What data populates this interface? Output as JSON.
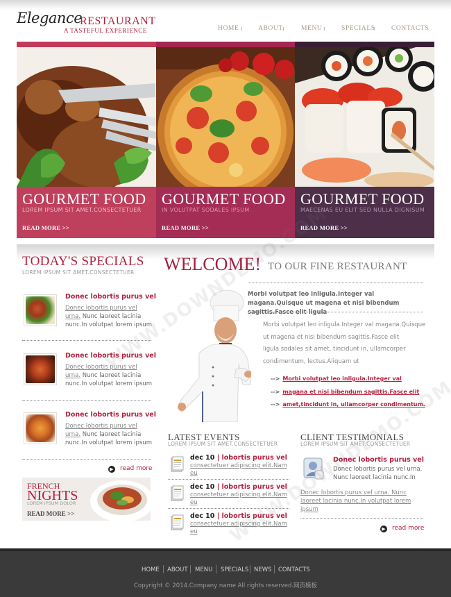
{
  "logo": {
    "script": "Elegance",
    "word": "RESTAURANT",
    "tagline": "A TASTEFUL EXPERIENCE"
  },
  "nav": {
    "items": [
      "HOME",
      "ABOUT",
      "MENU",
      "SPECIALS",
      "CONTACTS"
    ]
  },
  "banner": [
    {
      "title": "GOURMET FOOD",
      "subtitle": "LOREM IPSUM SIT AMET.CONSECTETUER",
      "more": "READ MORE >>"
    },
    {
      "title": "GOURMET FOOD",
      "subtitle": "IN VOLUTPAT SODALES IPSUM",
      "more": "READ MORE >>"
    },
    {
      "title": "GOURMET FOOD",
      "subtitle": "MAECENAS EU ELIT SED NULLA DIGNISUM",
      "more": "READ MORE >>"
    }
  ],
  "specials": {
    "title": "TODAY'S SPECIALS",
    "subtitle": "LOREM IPSUM SIT AMET.CONSECTETUER",
    "items": [
      {
        "heading": "Donec lobortis purus vel",
        "line1": "Donec lobortis purus vel",
        "line2a": "urna.",
        "line2b": " Nunc laoreet lacinia",
        "line3": "nunc.In volutpat lorem ipsum"
      },
      {
        "heading": "Donec lobortis purus vel",
        "line1": "Donec lobortis purus vel",
        "line2a": "urna.",
        "line2b": " Nunc laoreet lacinia",
        "line3": "nunc.In volutpat lorem ipsum"
      },
      {
        "heading": "Donec lobortis purus vel",
        "line1": "Donec lobortis purus vel",
        "line2a": "urna.",
        "line2b": " Nunc laoreet lacinia",
        "line3": "nunc.In volutpat lorem ipsum"
      }
    ],
    "read_more": "read more"
  },
  "french": {
    "line1": "FRENCH",
    "line2": "NIGHTS",
    "line3": "LOREM IPSUM DOLOR",
    "more": "READ MORE >>"
  },
  "welcome": {
    "big": "WELCOME!",
    "small": "TO OUR FINE RESTAURANT",
    "bold": "Morbi volutpat leo inligula.Integer val magana.Quisque ut magena et nisi bibendum sagittis.Fasce elit ligula",
    "body": "Morbi volutpat leo inligula.Integer val magana.Quisque ut magena et nisi bibendum sagittis.Fasce elit ligula.sodales sit amet, tincidunt in, ullamcorper condimentum, lectus.Aliquam ut",
    "arrow": "-->",
    "links": [
      "Morbi volutpat leo inligula.Integer val",
      "magana et nisi bibendum sagittis.Fasce elit",
      "amet,tincidunt in, ullamcorper condimentum."
    ]
  },
  "events": {
    "title": "LATEST EVENTS",
    "subtitle": "LOREM IPSUM SIT AMET.CONSECTETUER",
    "items": [
      {
        "date": "dec 10",
        "sep": " | ",
        "title": "lobortis purus vel",
        "line1": "consectetuer adipiscing elit.Nam",
        "line2": "eu"
      },
      {
        "date": "dec 10",
        "sep": " | ",
        "title": "lobortis purus vel",
        "line1": "consectetuer adipiscing elit.Nam",
        "line2": "eu"
      },
      {
        "date": "dec 10",
        "sep": " | ",
        "title": "lobortis purus vel",
        "line1": "consectetuer adipiscing elit.Nam",
        "line2": "eu"
      }
    ]
  },
  "testimonials": {
    "title": "CLIENT TESTIMONIALS",
    "subtitle": "LOREM IPSUM SIT AMET.CONSECTETUER",
    "heading": "Donec lobortis purus vel",
    "text": "Donec lobortis purus vel urna. Nunc laoreet lacinia nunc.In",
    "link": "Donec lobortis purus vel urna. Nunc laoreet lacinia nunc.In volutpat lorem ipsum",
    "read_more": "read more"
  },
  "footer": {
    "nav": [
      "HOME",
      "ABOUT",
      "MENU",
      "SPECIALS",
      "NEWS",
      "CONTACTS"
    ],
    "copyright": "Copyright © 2014.Company name All rights reserved.网页模板"
  },
  "watermark": "WWW.DOWNDEMO.COM",
  "colors": {
    "accent": "#b3213f",
    "banner1": "#b8304f",
    "banner2": "#9d1d48",
    "banner3": "#43243f",
    "footer": "#3a3a3a"
  }
}
